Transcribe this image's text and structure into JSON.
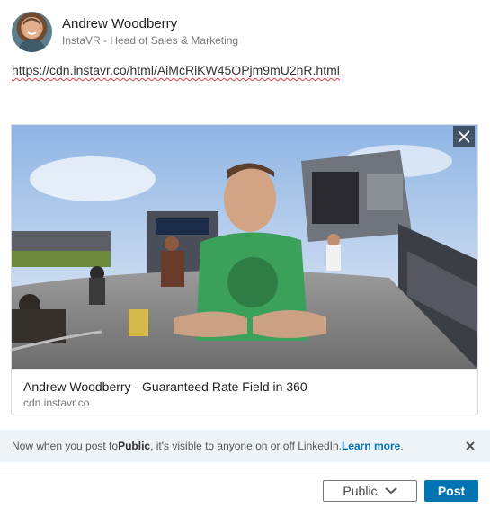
{
  "author": {
    "name": "Andrew Woodberry",
    "headline": "InstaVR - Head of Sales & Marketing"
  },
  "post": {
    "url": "https://cdn.instavr.co/html/AiMcRiKW45OPjm9mU2hR.html"
  },
  "link_preview": {
    "title": "Andrew Woodberry - Guaranteed Rate Field in 360",
    "domain": "cdn.instavr.co",
    "close_icon": "close-icon"
  },
  "notice": {
    "prefix": "Now when you post to ",
    "audience": "Public",
    "suffix": ", it's visible to anyone on or off LinkedIn. ",
    "learn_more": "Learn more",
    "end": "."
  },
  "footer": {
    "visibility_label": "Public",
    "post_label": "Post"
  },
  "colors": {
    "primary": "#0073b1",
    "notice_bg": "#eef3f8",
    "spellcheck": "#e23b3b"
  }
}
